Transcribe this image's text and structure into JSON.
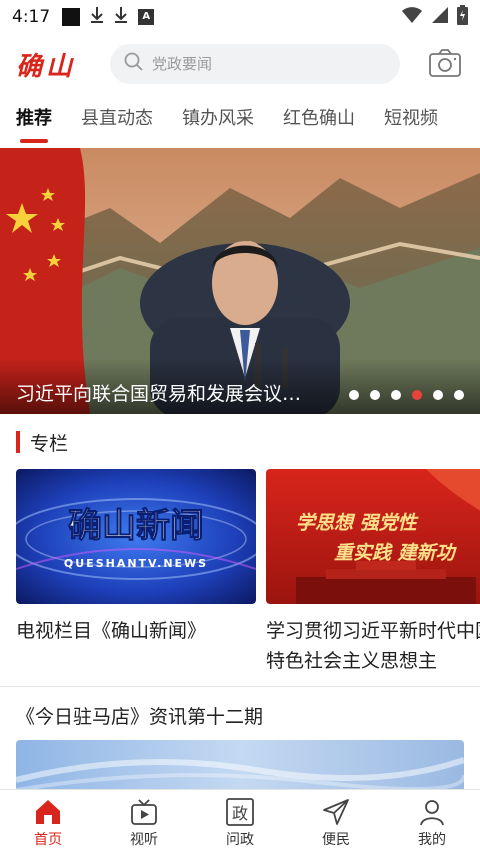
{
  "status_bar": {
    "time": "4:17",
    "icons": [
      "notification-square-icon",
      "download-icon",
      "download-icon",
      "a-badge-icon",
      "wifi-icon",
      "signal-icon",
      "battery-icon"
    ]
  },
  "header": {
    "logo_text": "确山",
    "search_placeholder": "党政要闻",
    "camera_icon": "camera-icon"
  },
  "tabs": [
    {
      "label": "推荐",
      "active": true
    },
    {
      "label": "县直动态",
      "active": false
    },
    {
      "label": "镇办风采",
      "active": false
    },
    {
      "label": "红色确山",
      "active": false
    },
    {
      "label": "短视频",
      "active": false
    }
  ],
  "banner": {
    "caption": "习近平向联合国贸易和发展会议第十五届会议开幕式发表视频致辞",
    "dot_count": 6,
    "active_dot": 3
  },
  "section": {
    "title": "专栏",
    "cards": [
      {
        "title": "电视栏目《确山新闻》",
        "image_text": "确山新闻",
        "image_subtext": "QUESHANTV.NEWS"
      },
      {
        "title": "学习贯彻习近平新时代中国特色社会主义思想主",
        "image_text_line1": "学思想 强党性",
        "image_text_line2": "重实践 建新功"
      }
    ]
  },
  "news": {
    "title": "《今日驻马店》资讯第十二期"
  },
  "bottom_nav": [
    {
      "label": "首页",
      "icon": "home-icon",
      "active": true
    },
    {
      "label": "视听",
      "icon": "tv-icon",
      "active": false
    },
    {
      "label": "问政",
      "icon": "zheng-icon",
      "active": false
    },
    {
      "label": "便民",
      "icon": "send-icon",
      "active": false
    },
    {
      "label": "我的",
      "icon": "user-icon",
      "active": false
    }
  ],
  "colors": {
    "accent": "#d9261c",
    "active_dot": "#e8433a"
  }
}
